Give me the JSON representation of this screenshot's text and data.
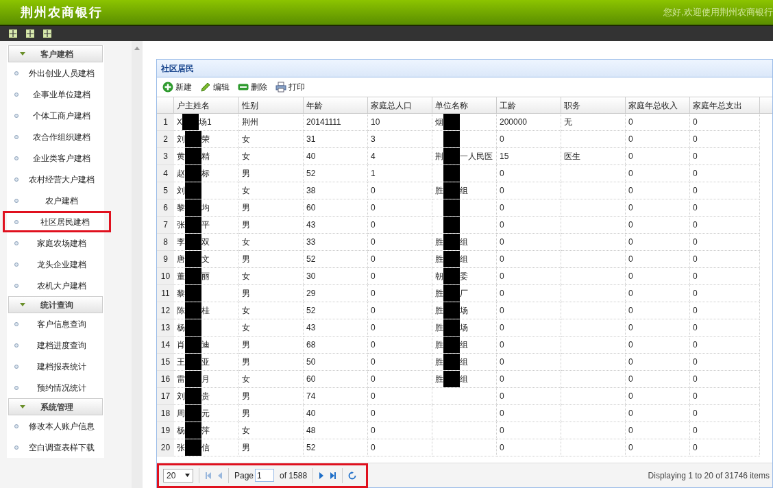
{
  "header": {
    "title": "荆州农商银行",
    "greeting": "您好,欢迎使用荆州农商银行"
  },
  "sidebar": {
    "sections": [
      {
        "title": "客户建档",
        "expanded": true,
        "items": [
          {
            "label": "外出创业人员建档",
            "selected": false
          },
          {
            "label": "企事业单位建档",
            "selected": false
          },
          {
            "label": "个体工商户建档",
            "selected": false
          },
          {
            "label": "农合作组织建档",
            "selected": false
          },
          {
            "label": "企业类客户建档",
            "selected": false
          },
          {
            "label": "农村经营大户建档",
            "selected": false
          },
          {
            "label": "农户建档",
            "selected": false
          },
          {
            "label": "社区居民建档",
            "selected": true
          },
          {
            "label": "家庭农场建档",
            "selected": false
          },
          {
            "label": "龙头企业建档",
            "selected": false
          },
          {
            "label": "农机大户建档",
            "selected": false
          }
        ]
      },
      {
        "title": "统计查询",
        "expanded": true,
        "items": [
          {
            "label": "客户信息查询",
            "selected": false
          },
          {
            "label": "建档进度查询",
            "selected": false
          },
          {
            "label": "建档报表统计",
            "selected": false
          },
          {
            "label": "预约情况统计",
            "selected": false
          }
        ]
      },
      {
        "title": "系统管理",
        "expanded": true,
        "items": [
          {
            "label": "修改本人账户信息",
            "selected": false
          },
          {
            "label": "空白调查表样下载",
            "selected": false
          }
        ]
      }
    ]
  },
  "panel": {
    "title": "社区居民",
    "actions": [
      {
        "label": "新建",
        "kind": "add"
      },
      {
        "label": "编辑",
        "kind": "edit"
      },
      {
        "label": "删除",
        "kind": "delete"
      },
      {
        "label": "打印",
        "kind": "print"
      }
    ],
    "columns": [
      "户主姓名",
      "性别",
      "年龄",
      "家庭总人口",
      "单位名称",
      "工龄",
      "职务",
      "家庭年总收入",
      "家庭年总支出"
    ],
    "rows": [
      {
        "number": "1",
        "cells": [
          {
            "redacted": true,
            "before": "X",
            "after": "场1"
          },
          "荆州",
          "20141111",
          "10",
          {
            "redacted": true,
            "before": "烟"
          },
          "200000",
          "无",
          "0",
          "0"
        ]
      },
      {
        "number": "2",
        "cells": [
          {
            "redacted": true,
            "before": "刘",
            "after": "荣"
          },
          "女",
          "31",
          "3",
          {
            "redacted": true
          },
          "0",
          "",
          "0",
          "0"
        ]
      },
      {
        "number": "3",
        "cells": [
          {
            "redacted": true,
            "before": "黄",
            "after": "精"
          },
          "女",
          "40",
          "4",
          {
            "redacted": true,
            "before": "荆",
            "after": "一人民医"
          },
          "15",
          "医生",
          "0",
          "0"
        ]
      },
      {
        "number": "4",
        "cells": [
          {
            "redacted": true,
            "before": "赵",
            "after": "标"
          },
          "男",
          "52",
          "1",
          {
            "redacted": true
          },
          "0",
          "",
          "0",
          "0"
        ]
      },
      {
        "number": "5",
        "cells": [
          {
            "redacted": true,
            "before": "刘"
          },
          "女",
          "38",
          "0",
          {
            "redacted": true,
            "before": "胜",
            "after": "组"
          },
          "0",
          "",
          "0",
          "0"
        ]
      },
      {
        "number": "6",
        "cells": [
          {
            "redacted": true,
            "before": "黎",
            "after": "均"
          },
          "男",
          "60",
          "0",
          {
            "redacted": true
          },
          "0",
          "",
          "0",
          "0"
        ]
      },
      {
        "number": "7",
        "cells": [
          {
            "redacted": true,
            "before": "张",
            "after": "平"
          },
          "男",
          "43",
          "0",
          {
            "redacted": true
          },
          "0",
          "",
          "0",
          "0"
        ]
      },
      {
        "number": "8",
        "cells": [
          {
            "redacted": true,
            "before": "李",
            "after": "双"
          },
          "女",
          "33",
          "0",
          {
            "redacted": true,
            "before": "胜",
            "after": "组"
          },
          "0",
          "",
          "0",
          "0"
        ]
      },
      {
        "number": "9",
        "cells": [
          {
            "redacted": true,
            "before": "唐",
            "after": "文"
          },
          "男",
          "52",
          "0",
          {
            "redacted": true,
            "before": "胜",
            "after": "组"
          },
          "0",
          "",
          "0",
          "0"
        ]
      },
      {
        "number": "10",
        "cells": [
          {
            "redacted": true,
            "before": "董",
            "after": "丽"
          },
          "女",
          "30",
          "0",
          {
            "redacted": true,
            "before": "朝",
            "after": "委"
          },
          "0",
          "",
          "0",
          "0"
        ]
      },
      {
        "number": "11",
        "cells": [
          {
            "redacted": true,
            "before": "黎"
          },
          "男",
          "29",
          "0",
          {
            "redacted": true,
            "before": "胜",
            "after": "厂"
          },
          "0",
          "",
          "0",
          "0"
        ]
      },
      {
        "number": "12",
        "cells": [
          {
            "redacted": true,
            "before": "陈",
            "after": "桂"
          },
          "女",
          "52",
          "0",
          {
            "redacted": true,
            "before": "胜",
            "after": "场"
          },
          "0",
          "",
          "0",
          "0"
        ]
      },
      {
        "number": "13",
        "cells": [
          {
            "redacted": true,
            "before": "杨"
          },
          "女",
          "43",
          "0",
          {
            "redacted": true,
            "before": "胜",
            "after": "场"
          },
          "0",
          "",
          "0",
          "0"
        ]
      },
      {
        "number": "14",
        "cells": [
          {
            "redacted": true,
            "before": "肖",
            "after": "迪"
          },
          "男",
          "68",
          "0",
          {
            "redacted": true,
            "before": "胜",
            "after": "组"
          },
          "0",
          "",
          "0",
          "0"
        ]
      },
      {
        "number": "15",
        "cells": [
          {
            "redacted": true,
            "before": "王",
            "after": "亚"
          },
          "男",
          "50",
          "0",
          {
            "redacted": true,
            "before": "胜",
            "after": "组"
          },
          "0",
          "",
          "0",
          "0"
        ]
      },
      {
        "number": "16",
        "cells": [
          {
            "redacted": true,
            "before": "雷",
            "after": "月"
          },
          "女",
          "60",
          "0",
          {
            "redacted": true,
            "before": "胜",
            "after": "组"
          },
          "0",
          "",
          "0",
          "0"
        ]
      },
      {
        "number": "17",
        "cells": [
          {
            "redacted": true,
            "before": "刘",
            "after": "贵"
          },
          "男",
          "74",
          "0",
          "",
          "0",
          "",
          "0",
          "0"
        ]
      },
      {
        "number": "18",
        "cells": [
          {
            "redacted": true,
            "before": "周",
            "after": "元"
          },
          "男",
          "40",
          "0",
          "",
          "0",
          "",
          "0",
          "0"
        ]
      },
      {
        "number": "19",
        "cells": [
          {
            "redacted": true,
            "before": "杨",
            "after": "萍"
          },
          "女",
          "48",
          "0",
          "",
          "0",
          "",
          "0",
          "0"
        ]
      },
      {
        "number": "20",
        "cells": [
          {
            "redacted": true,
            "before": "张",
            "after": "信"
          },
          "男",
          "52",
          "0",
          "",
          "0",
          "",
          "0",
          "0"
        ]
      }
    ],
    "pager": {
      "highlighted": true,
      "page_size": "20",
      "page_label": "Page",
      "page": "1",
      "page_count": "of 1588",
      "status": "Displaying 1 to 20 of 31746 items"
    }
  }
}
